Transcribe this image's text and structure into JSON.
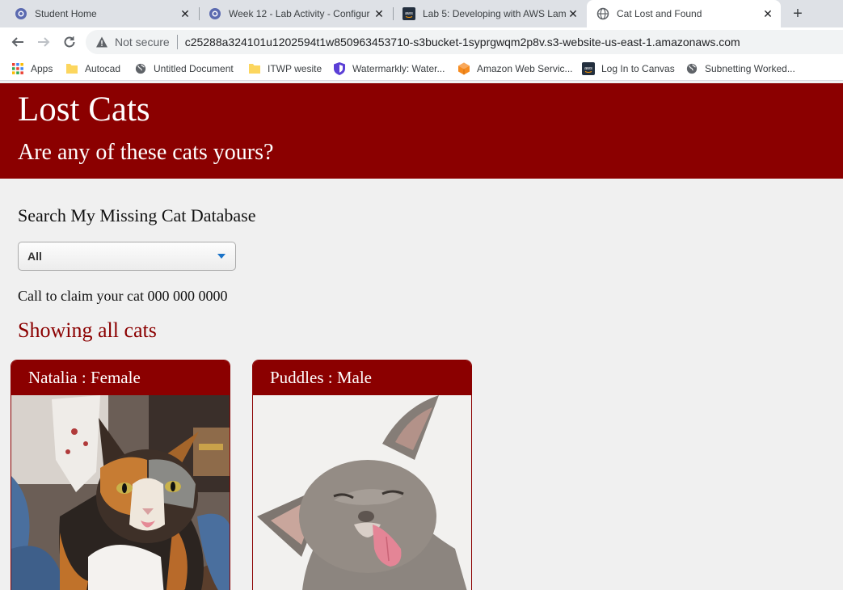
{
  "browser": {
    "tabs": [
      {
        "title": "Student Home",
        "icon": "course-site-icon"
      },
      {
        "title": "Week 12 - Lab Activity - Configur",
        "icon": "course-site-icon"
      },
      {
        "title": "Lab 5: Developing with AWS Lam",
        "icon": "aws-icon"
      },
      {
        "title": "Cat Lost and Found",
        "icon": "globe-icon",
        "active": true
      }
    ],
    "security_label": "Not secure",
    "url": "c25288a324101u1202594t1w850963453710-s3bucket-1syprgwqm2p8v.s3-website-us-east-1.amazonaws.com",
    "bookmarks": [
      {
        "label": "Apps",
        "icon": "apps-grid-icon"
      },
      {
        "label": "Autocad",
        "icon": "folder-icon"
      },
      {
        "label": "Untitled Document",
        "icon": "globe-icon"
      },
      {
        "label": "ITWP wesite",
        "icon": "folder-icon"
      },
      {
        "label": "Watermarkly: Water...",
        "icon": "shield-icon"
      },
      {
        "label": "Amazon Web Servic...",
        "icon": "aws-cube-icon"
      },
      {
        "label": "Log In to Canvas",
        "icon": "aws-icon"
      },
      {
        "label": "Subnetting Worked...",
        "icon": "globe-icon"
      }
    ]
  },
  "page": {
    "title": "Lost Cats",
    "subtitle": "Are any of these cats yours?",
    "search_label": "Search My Missing Cat Database",
    "filter_selected": "All",
    "call_text": "Call to claim your cat 000 000 0000",
    "showing_text": "Showing all cats",
    "cats": [
      {
        "heading": "Natalia : Female"
      },
      {
        "heading": "Puddles : Male"
      }
    ]
  },
  "colors": {
    "brand": "#8b0000",
    "page_bg": "#f0f0f0",
    "tabbar_bg": "#dee1e6"
  }
}
